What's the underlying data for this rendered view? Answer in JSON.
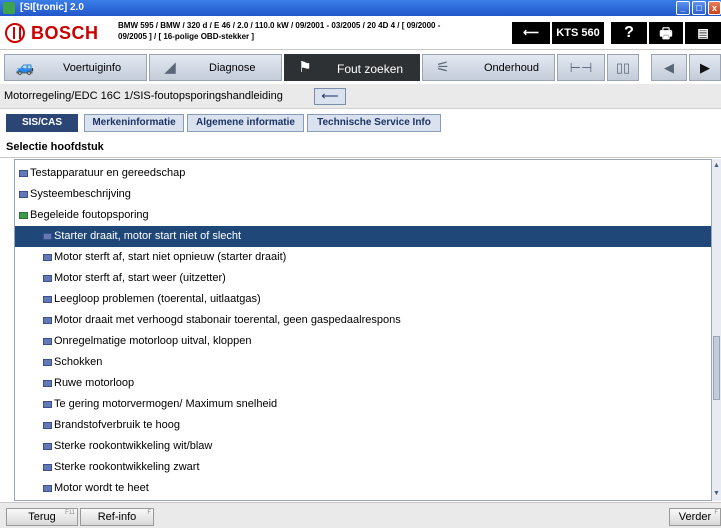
{
  "window": {
    "title": "[SI[tronic] 2.0"
  },
  "header": {
    "brand": "BOSCH",
    "vehicle_line1": "BMW 595 / BMW / 320 d / E 46 / 2.0 / 110.0 kW / 09/2001 - 03/2005 / 20 4D 4 / [ 09/2000 -",
    "vehicle_line2": "09/2005 ] / [ 16-polige OBD-stekker ]",
    "back_icon": "back-arrow-icon",
    "kts_label": "KTS 560",
    "help_label": "?",
    "print_icon": "printer-icon",
    "more_icon": "menu-icon"
  },
  "nav": {
    "tabs": [
      {
        "label": "Voertuiginfo",
        "icon": "car-icon"
      },
      {
        "label": "Diagnose",
        "icon": "diagnosis-icon"
      },
      {
        "label": "Fout zoeken",
        "icon": "troubleshoot-icon",
        "active": true
      },
      {
        "label": "Onderhoud",
        "icon": "maintenance-icon"
      }
    ],
    "extra_icons": [
      "measure-icon",
      "book-icon",
      "prev-icon",
      "next-icon"
    ]
  },
  "breadcrumb": {
    "text": "Motorregeling/EDC 16C 1/SIS-foutopsporingshandleiding"
  },
  "subtabs": [
    {
      "label": "SIS/CAS",
      "active": true
    },
    {
      "label": "Merkeninformatie"
    },
    {
      "label": "Algemene informatie"
    },
    {
      "label": "Technische Service Info"
    }
  ],
  "section": {
    "title": "Selectie hoofdstuk"
  },
  "list": {
    "items": [
      {
        "label": "Testapparatuur en gereedschap",
        "level": 0,
        "icon": "closed"
      },
      {
        "label": "Systeembeschrijving",
        "level": 0,
        "icon": "closed"
      },
      {
        "label": "Begeleide foutopsporing",
        "level": 0,
        "icon": "open"
      },
      {
        "label": "Starter draait, motor start niet of slecht",
        "level": 1,
        "selected": true
      },
      {
        "label": "Motor sterft af, start niet opnieuw (starter draait)",
        "level": 1
      },
      {
        "label": "Motor sterft af, start weer (uitzetter)",
        "level": 1
      },
      {
        "label": "Leegloop problemen (toerental, uitlaatgas)",
        "level": 1
      },
      {
        "label": "Motor draait met verhoogd stabonair toerental, geen gaspedaalrespons",
        "level": 1
      },
      {
        "label": "Onregelmatige motorloop uitval, kloppen",
        "level": 1
      },
      {
        "label": "Schokken",
        "level": 1
      },
      {
        "label": "Ruwe motorloop",
        "level": 1
      },
      {
        "label": "Te gering motorvermogen/ Maximum snelheid",
        "level": 1
      },
      {
        "label": "Brandstofverbruik te hoog",
        "level": 1
      },
      {
        "label": "Sterke rookontwikkeling wit/blaw",
        "level": 1
      },
      {
        "label": "Sterke rookontwikkeling zwart",
        "level": 1
      },
      {
        "label": "Motor wordt te heet",
        "level": 1
      }
    ]
  },
  "footer": {
    "back_label": "Terug",
    "back_key": "F11",
    "refinfo_label": "Ref-info",
    "refinfo_key": "F",
    "next_label": "Verder",
    "next_key": "F"
  },
  "colors": {
    "brand_red": "#cc0000",
    "selection": "#1f4777",
    "active_tab": "#2e3134"
  }
}
